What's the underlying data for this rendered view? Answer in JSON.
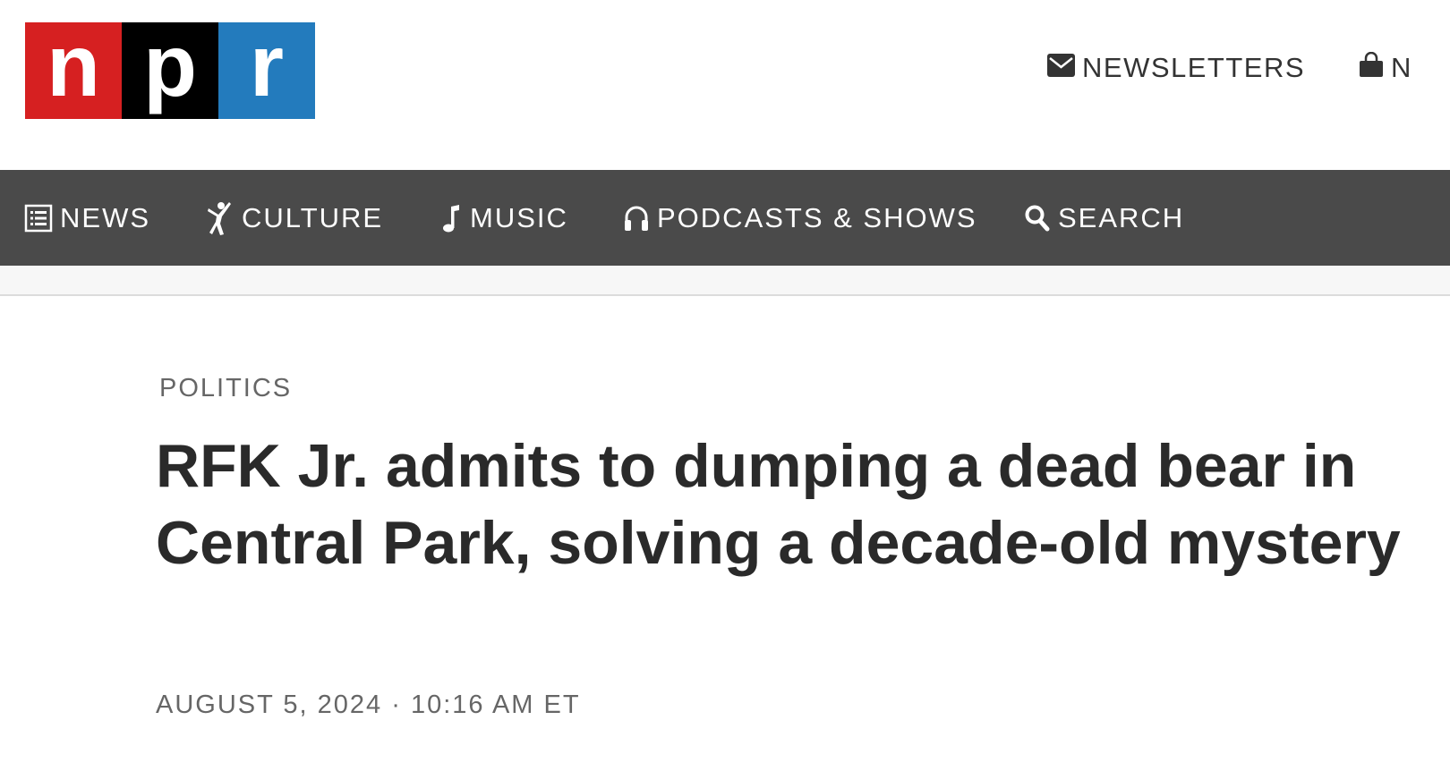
{
  "logo": {
    "n": "n",
    "p": "p",
    "r": "r",
    "colors": {
      "n": "#d62021",
      "p": "#000000",
      "r": "#237bbd"
    }
  },
  "utility_nav": {
    "newsletters": {
      "label": "NEWSLETTERS",
      "icon": "envelope-icon"
    },
    "shop": {
      "label": "N",
      "icon": "shopping-bag-icon"
    }
  },
  "main_nav": {
    "background": "#4a4a4a",
    "items": [
      {
        "label": "NEWS",
        "icon": "news-list-icon"
      },
      {
        "label": "CULTURE",
        "icon": "culture-figure-icon"
      },
      {
        "label": "MUSIC",
        "icon": "music-note-icon"
      },
      {
        "label": "PODCASTS & SHOWS",
        "icon": "headphones-icon"
      },
      {
        "label": "SEARCH",
        "icon": "search-icon"
      }
    ]
  },
  "article": {
    "section": "POLITICS",
    "headline": "RFK Jr. admits to dumping a dead bear in Central Park, solving a decade-old mystery",
    "date": "AUGUST 5, 2024",
    "separator": "·",
    "time": "10:16 AM ET"
  }
}
